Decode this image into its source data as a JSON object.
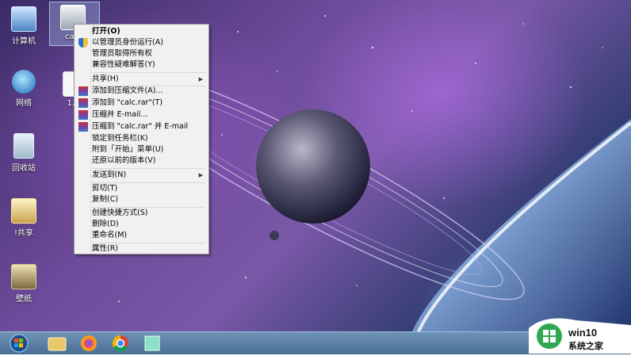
{
  "desktop": {
    "icons": [
      {
        "label": "计算机"
      },
      {
        "label": "calc"
      },
      {
        "label": "网络"
      },
      {
        "label": "1.c"
      },
      {
        "label": "回收站"
      },
      {
        "label": "!共享"
      },
      {
        "label": "壁纸"
      }
    ]
  },
  "context_menu": {
    "items": [
      {
        "label": "打开(O)"
      },
      {
        "label": "以管理员身份运行(A)"
      },
      {
        "label": "管理员取得所有权"
      },
      {
        "label": "兼容性疑难解答(Y)"
      },
      {
        "label": "共享(H)"
      },
      {
        "label": "添加到压缩文件(A)..."
      },
      {
        "label": "添加到 \"calc.rar\"(T)"
      },
      {
        "label": "压缩并 E-mail..."
      },
      {
        "label": "压缩到 \"calc.rar\" 并 E-mail"
      },
      {
        "label": "锁定到任务栏(K)"
      },
      {
        "label": "附到「开始」菜单(U)"
      },
      {
        "label": "还原以前的版本(V)"
      },
      {
        "label": "发送到(N)"
      },
      {
        "label": "剪切(T)"
      },
      {
        "label": "复制(C)"
      },
      {
        "label": "创建快捷方式(S)"
      },
      {
        "label": "删除(D)"
      },
      {
        "label": "重命名(M)"
      },
      {
        "label": "属性(R)"
      }
    ]
  },
  "watermark": {
    "site": "win10",
    "tagline": "系统之家"
  },
  "colors": {
    "menu_bg": "#f1f1f1",
    "taskbar": "#5a80a5",
    "watermark_green": "#2fa84f"
  }
}
